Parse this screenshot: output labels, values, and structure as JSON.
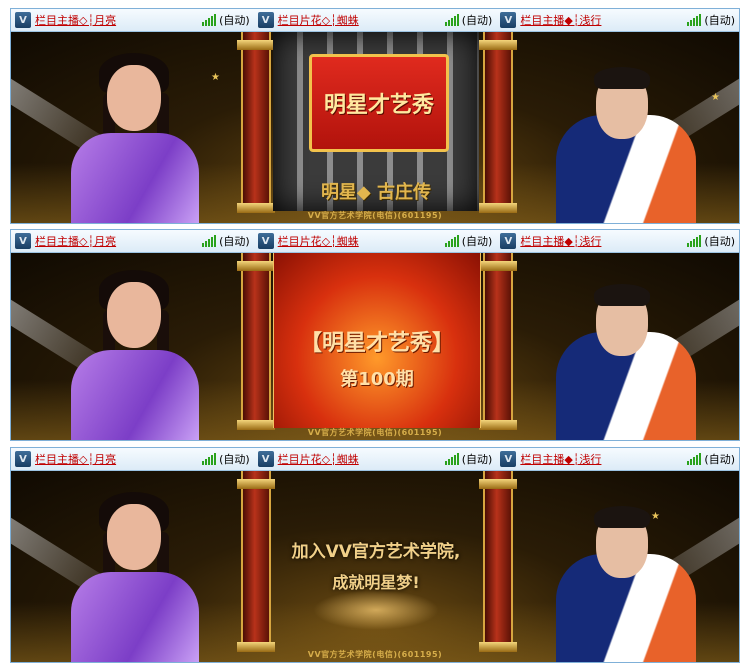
{
  "panels": [
    {
      "hosts": [
        {
          "name": "栏目主播◇┆月亮",
          "mode": "(自动)"
        },
        {
          "name": "栏目片花◇┆蜘蛛",
          "mode": "(自动)"
        },
        {
          "name": "栏目主播◆┆浅行",
          "mode": "(自动)"
        }
      ],
      "center": {
        "sign": "明星才艺秀",
        "ribbon": "明星◆ 古庄传"
      },
      "footer": "VV官方艺术学院(电信)(601195)"
    },
    {
      "hosts": [
        {
          "name": "栏目主播◇┆月亮",
          "mode": "(自动)"
        },
        {
          "name": "栏目片花◇┆蜘蛛",
          "mode": "(自动)"
        },
        {
          "name": "栏目主播◆┆浅行",
          "mode": "(自动)"
        }
      ],
      "center": {
        "title": "【明星才艺秀】",
        "subtitle": "第100期"
      },
      "footer": "VV官方艺术学院(电信)(601195)"
    },
    {
      "hosts": [
        {
          "name": "栏目主播◇┆月亮",
          "mode": "(自动)"
        },
        {
          "name": "栏目片花◇┆蜘蛛",
          "mode": "(自动)"
        },
        {
          "name": "栏目主播◆┆浅行",
          "mode": "(自动)"
        }
      ],
      "center": {
        "line1": "加入VV官方艺术学院,",
        "line2": "成就明星梦!"
      },
      "footer": "VV官方艺术学院(电信)(601195)"
    }
  ],
  "icons": {
    "logo": "vv-logo-icon",
    "signal": "signal-strength-icon"
  },
  "colors": {
    "host_link": "#c00000",
    "signal": "#2aa21c",
    "frame_border": "#7fb0d8"
  }
}
